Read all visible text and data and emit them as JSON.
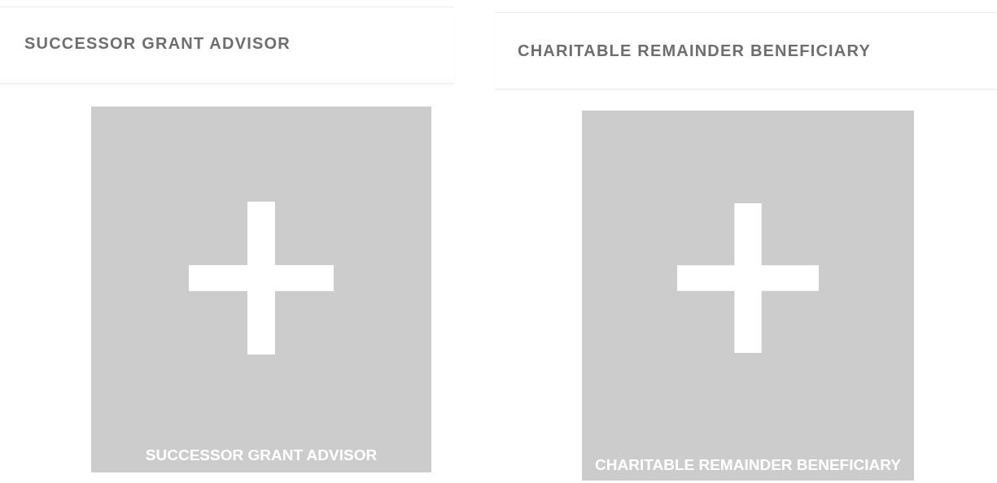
{
  "panels": [
    {
      "title": "SUCCESSOR GRANT ADVISOR",
      "tile": {
        "label": "SUCCESSOR GRANT ADVISOR"
      }
    },
    {
      "title": "CHARITABLE REMAINDER BENEFICIARY",
      "tile": {
        "label": "CHARITABLE REMAINDER BENEFICIARY"
      }
    }
  ]
}
